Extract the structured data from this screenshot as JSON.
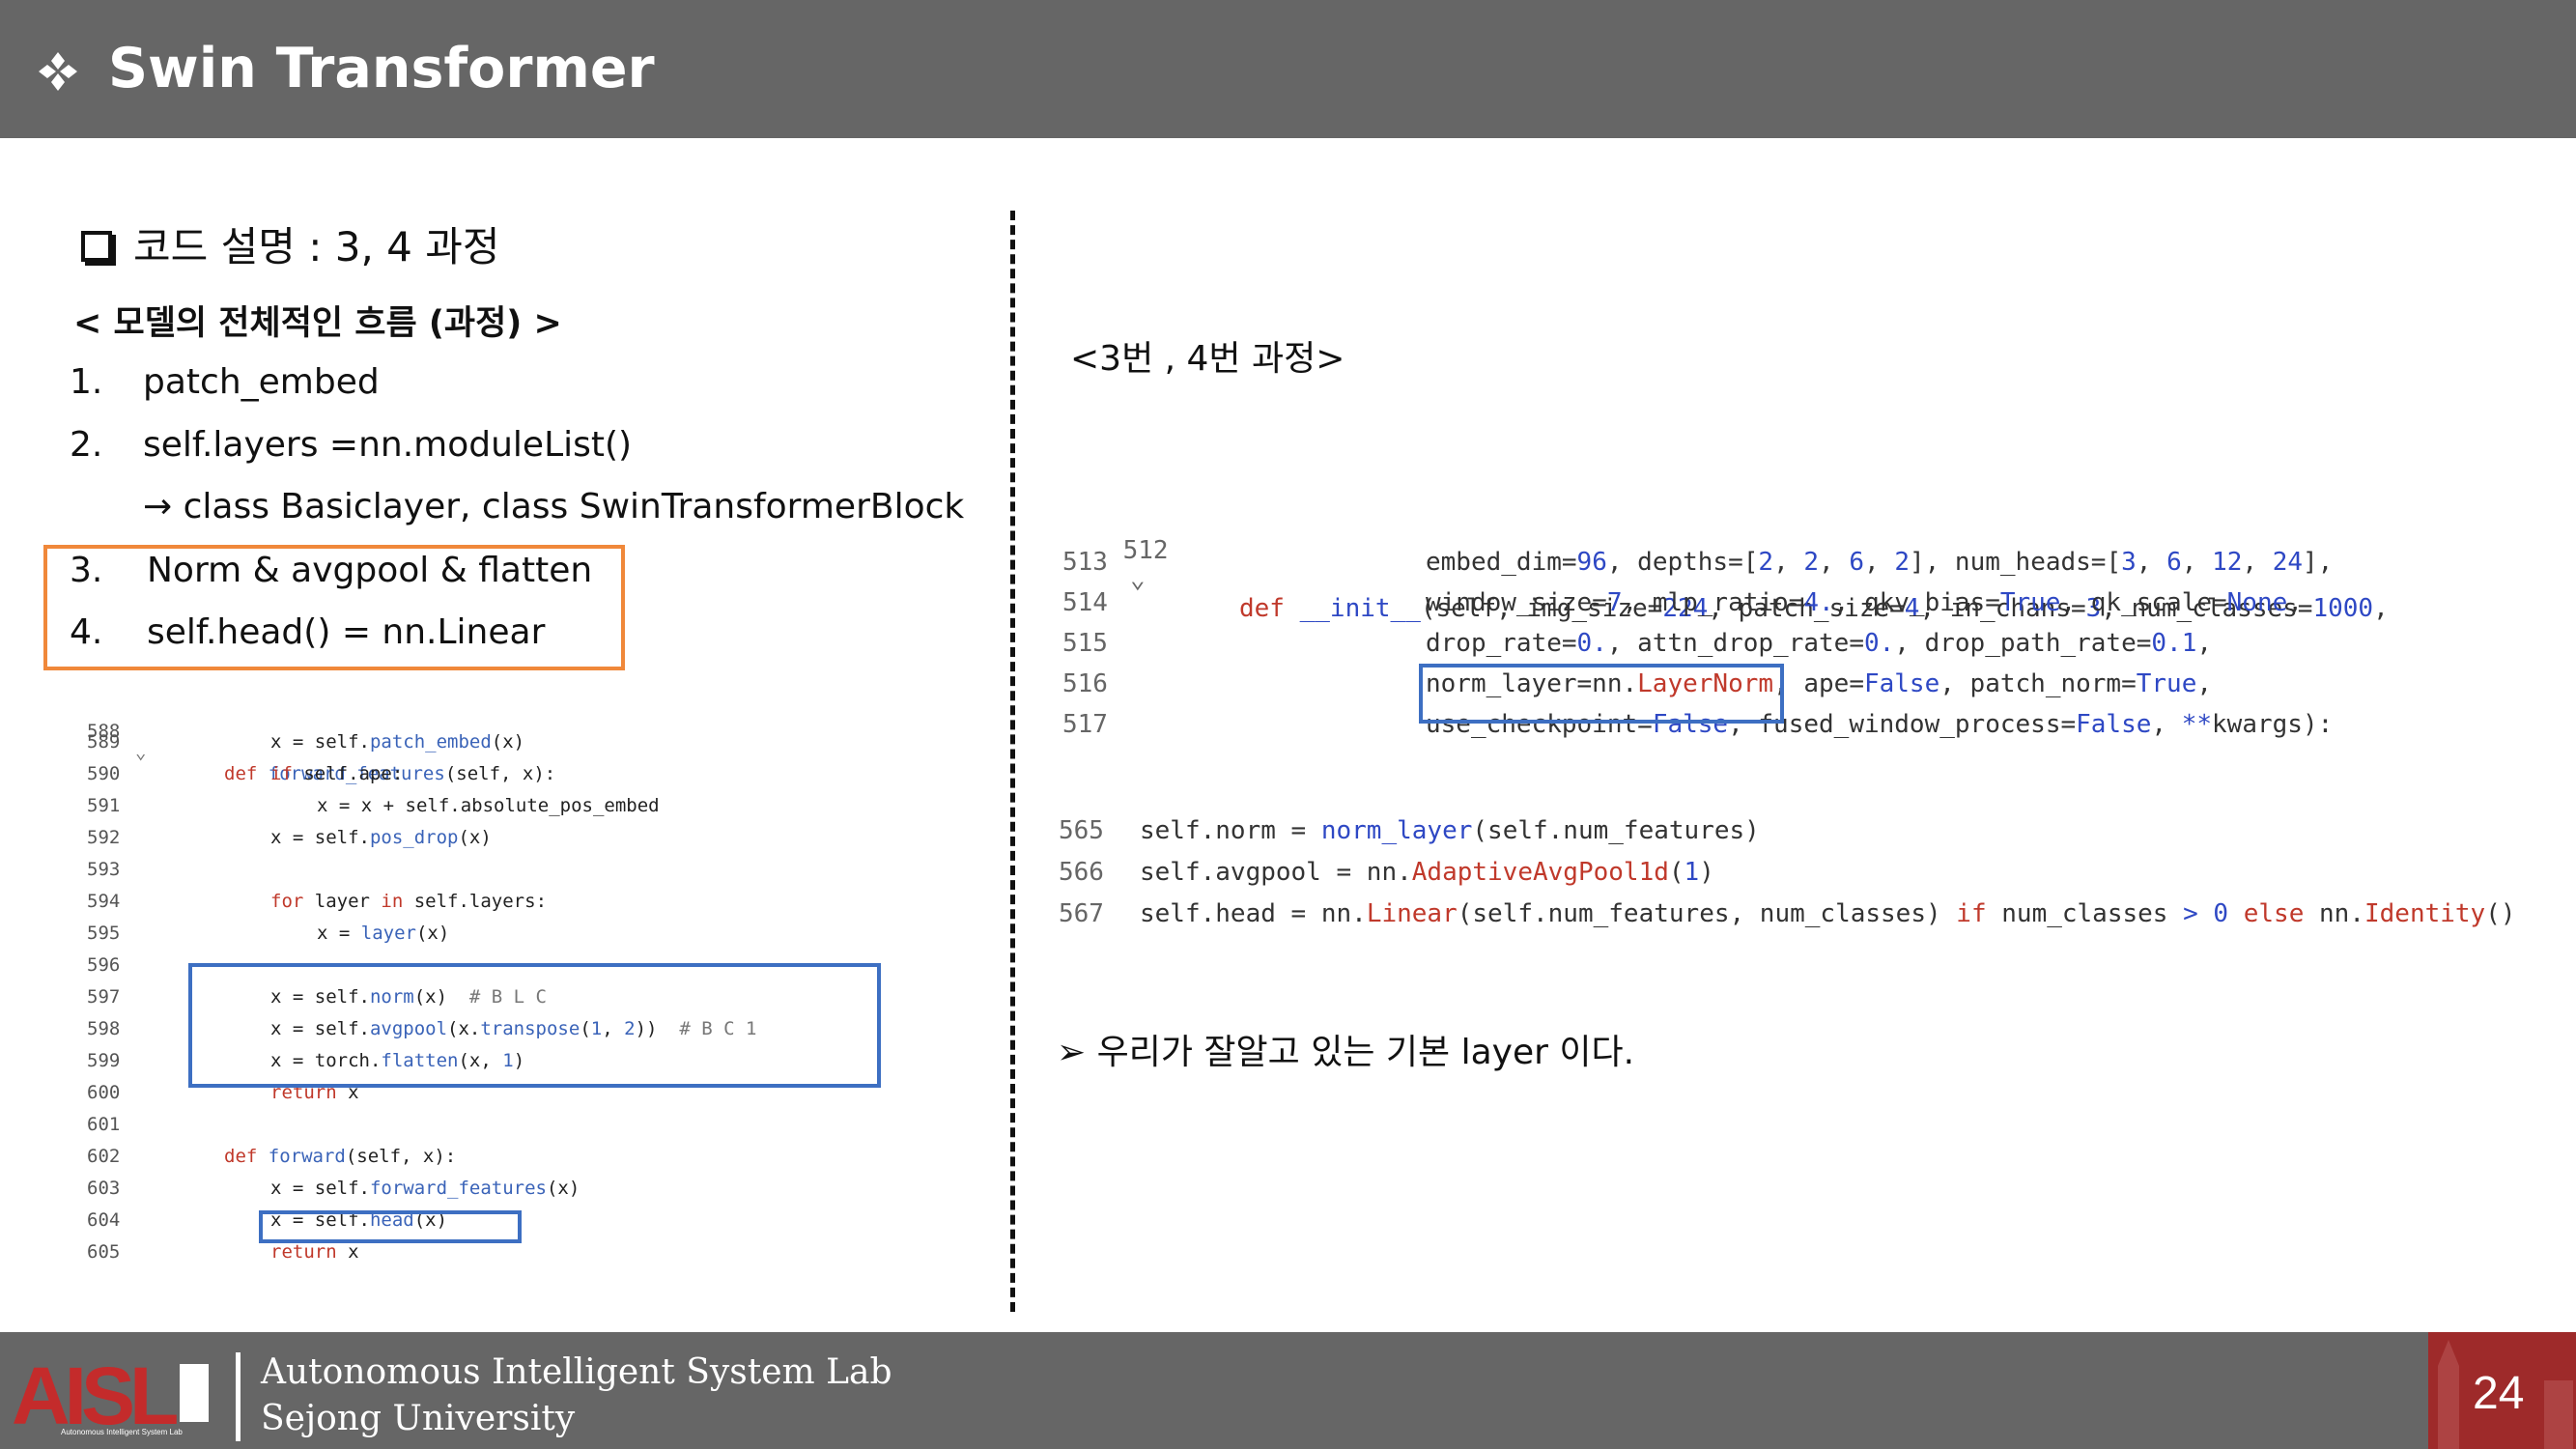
{
  "header": {
    "title": "Swin Transformer",
    "bullet_icon": "four-diamonds-icon"
  },
  "left": {
    "subtitle": "코드 설명 : 3, 4 과정",
    "flow_title": "< 모델의 전체적인 흐름 (과정) >",
    "items": [
      {
        "num": "1.",
        "text": "patch_embed"
      },
      {
        "num": "2.",
        "text": "self.layers =nn.moduleList()"
      },
      {
        "num": "",
        "text": "→ class Basiclayer, class SwinTransformerBlock"
      },
      {
        "num": "3.",
        "text": "Norm & avgpool & flatten"
      },
      {
        "num": "4.",
        "text": "self.head() = nn.Linear"
      }
    ]
  },
  "code_left": [
    {
      "ln": "588",
      "fold": "⌄",
      "code": "def forward_features(self, x):"
    },
    {
      "ln": "589",
      "code": "x = self.patch_embed(x)"
    },
    {
      "ln": "590",
      "code": "if self.ape:"
    },
    {
      "ln": "591",
      "code": "x = x + self.absolute_pos_embed"
    },
    {
      "ln": "592",
      "code": "x = self.pos_drop(x)"
    },
    {
      "ln": "593",
      "code": ""
    },
    {
      "ln": "594",
      "code": "for layer in self.layers:"
    },
    {
      "ln": "595",
      "code": "x = layer(x)"
    },
    {
      "ln": "596",
      "code": ""
    },
    {
      "ln": "597",
      "code": "x = self.norm(x)  # B L C"
    },
    {
      "ln": "598",
      "code": "x = self.avgpool(x.transpose(1, 2))  # B C 1"
    },
    {
      "ln": "599",
      "code": "x = torch.flatten(x, 1)"
    },
    {
      "ln": "600",
      "code": "return x"
    },
    {
      "ln": "601",
      "code": ""
    },
    {
      "ln": "602",
      "code": "def forward(self, x):"
    },
    {
      "ln": "603",
      "code": "x = self.forward_features(x)"
    },
    {
      "ln": "604",
      "code": "x = self.head(x)"
    },
    {
      "ln": "605",
      "code": "return x"
    }
  ],
  "right": {
    "heading": "<3번 , 4번 과정>",
    "code_init": [
      {
        "ln": "512",
        "fold": "⌄",
        "code": "def __init__(self, img_size=224, patch_size=4, in_chans=3, num_classes=1000,"
      },
      {
        "ln": "513",
        "code": "embed_dim=96, depths=[2, 2, 6, 2], num_heads=[3, 6, 12, 24],"
      },
      {
        "ln": "514",
        "code": "window_size=7, mlp_ratio=4., qkv_bias=True, qk_scale=None,"
      },
      {
        "ln": "515",
        "code": "drop_rate=0., attn_drop_rate=0., drop_path_rate=0.1,"
      },
      {
        "ln": "516",
        "code": "norm_layer=nn.LayerNorm, ape=False, patch_norm=True,"
      },
      {
        "ln": "517",
        "code": "use_checkpoint=False, fused_window_process=False, **kwargs):"
      }
    ],
    "code_body": [
      {
        "ln": "565",
        "code": "self.norm = norm_layer(self.num_features)"
      },
      {
        "ln": "566",
        "code": "self.avgpool = nn.AdaptiveAvgPool1d(1)"
      },
      {
        "ln": "567",
        "code": "self.head = nn.Linear(self.num_features, num_classes) if num_classes > 0 else nn.Identity()"
      }
    ],
    "note": "➢ 우리가 잘알고 있는 기본 layer 이다."
  },
  "footer": {
    "lab": "Autonomous Intelligent System Lab",
    "university": "Sejong University",
    "logo_text": "AISL",
    "logo_caption": "Autonomous Intelligent System Lab",
    "page": "24"
  },
  "colors": {
    "header_bg": "#666666",
    "orange_box": "#f0883a",
    "blue_box": "#3d6fc2",
    "footer_red": "#9e2a2a",
    "logo_red": "#c42b2b"
  }
}
